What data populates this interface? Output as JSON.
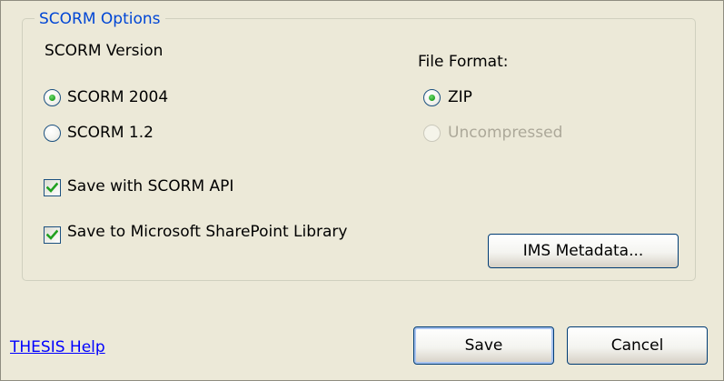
{
  "group": {
    "title": "SCORM Options"
  },
  "scorm_version": {
    "label": "SCORM Version",
    "options": [
      {
        "label": "SCORM 2004",
        "selected": true
      },
      {
        "label": "SCORM 1.2",
        "selected": false
      }
    ]
  },
  "file_format": {
    "label": "File Format:",
    "options": [
      {
        "label": "ZIP",
        "selected": true,
        "enabled": true
      },
      {
        "label": "Uncompressed",
        "selected": false,
        "enabled": false
      }
    ]
  },
  "checkboxes": [
    {
      "label": "Save with SCORM API",
      "checked": true
    },
    {
      "label": "Save to Microsoft SharePoint Library",
      "checked": true
    }
  ],
  "buttons": {
    "ims_metadata": "IMS Metadata...",
    "save": "Save",
    "cancel": "Cancel"
  },
  "help_link": "THESIS Help",
  "colors": {
    "dialog_bg": "#ece9d8",
    "group_title": "#0046d5",
    "check_mark": "#21a121",
    "link": "#0000ff"
  }
}
